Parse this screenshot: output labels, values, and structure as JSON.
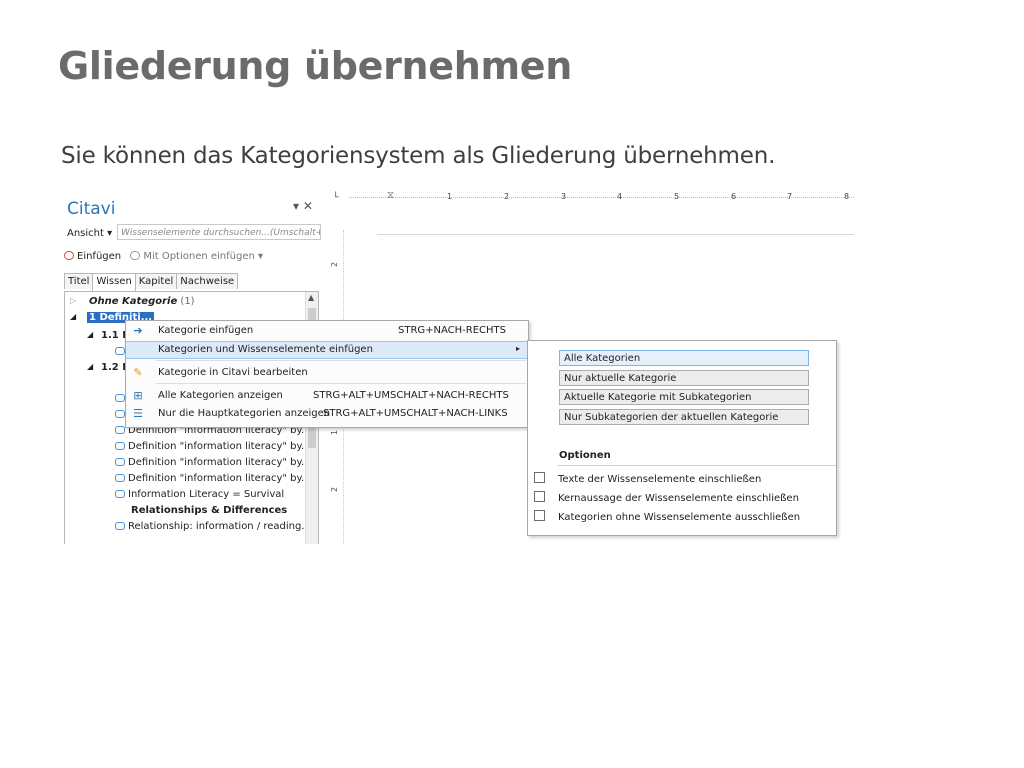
{
  "slide": {
    "title": "Gliederung übernehmen",
    "subtitle": "Sie können das Kategoriensystem als Gliederung übernehmen."
  },
  "citavi": {
    "title": "Citavi",
    "pane_controls": "▾ ✕",
    "view_menu": "Ansicht ▾",
    "search_placeholder": "Wissenselemente durchsuchen...(Umschalt+F",
    "insert_label": "Einfügen",
    "insert_options_label": "Mit Optionen einfügen ▾",
    "tabs": [
      "Titel",
      "Wissen",
      "Kapitel",
      "Nachweise"
    ],
    "active_tab": "Wissen",
    "tree": {
      "no_category": "Ohne Kategorie",
      "no_category_count": "(1)",
      "cat1": "1 Definiti...",
      "cat1_1": "1.1 In",
      "cat1_2": "1.2 In",
      "items": [
        "Definition \"information literacy\" by...",
        "Definition \"information literacy\" by...",
        "Definition \"information literacy\" by...",
        "Definition \"information literacy\" by...",
        "Information Literacy = Survival"
      ],
      "relationships_heading": "Relationships & Differences",
      "relationship_item": "Relationship: information / reading..."
    }
  },
  "ruler": {
    "numbers": [
      "1",
      "2",
      "3",
      "4",
      "5",
      "6",
      "7",
      "8"
    ],
    "vertical_numbers": [
      "2",
      "1",
      "2"
    ]
  },
  "context_menu": {
    "items": [
      {
        "label": "Kategorie einfügen",
        "shortcut": "STRG+NACH-RECHTS",
        "icon": "arrow-right-icon"
      },
      {
        "label": "Kategorien und Wissenselemente einfügen",
        "shortcut": "",
        "icon": "",
        "submenu": "▸"
      },
      {
        "label": "Kategorie in Citavi bearbeiten",
        "shortcut": "",
        "icon": "pencil-icon"
      },
      {
        "label": "Alle Kategorien anzeigen",
        "shortcut": "STRG+ALT+UMSCHALT+NACH-RECHTS",
        "icon": "tree-expand-icon"
      },
      {
        "label": "Nur die Hauptkategorien anzeigen",
        "shortcut": "STRG+ALT+UMSCHALT+NACH-LINKS",
        "icon": "list-icon"
      }
    ]
  },
  "submenu": {
    "buttons": [
      "Alle Kategorien",
      "Nur aktuelle Kategorie",
      "Aktuelle Kategorie mit Subkategorien",
      "Nur Subkategorien der aktuellen Kategorie"
    ],
    "options_header": "Optionen",
    "checkboxes": [
      {
        "label": "Texte der Wissenselemente einschließen",
        "checked": false
      },
      {
        "label": "Kernaussage der Wissenselemente einschließen",
        "checked": false
      },
      {
        "label": "Kategorien ohne Wissenselemente ausschließen",
        "checked": false
      }
    ]
  },
  "colors": {
    "title_gray": "#6b6b6b",
    "citavi_blue": "#2e75b6",
    "selection_blue": "#2b6fc1",
    "menu_highlight": "#dbe9f8"
  }
}
